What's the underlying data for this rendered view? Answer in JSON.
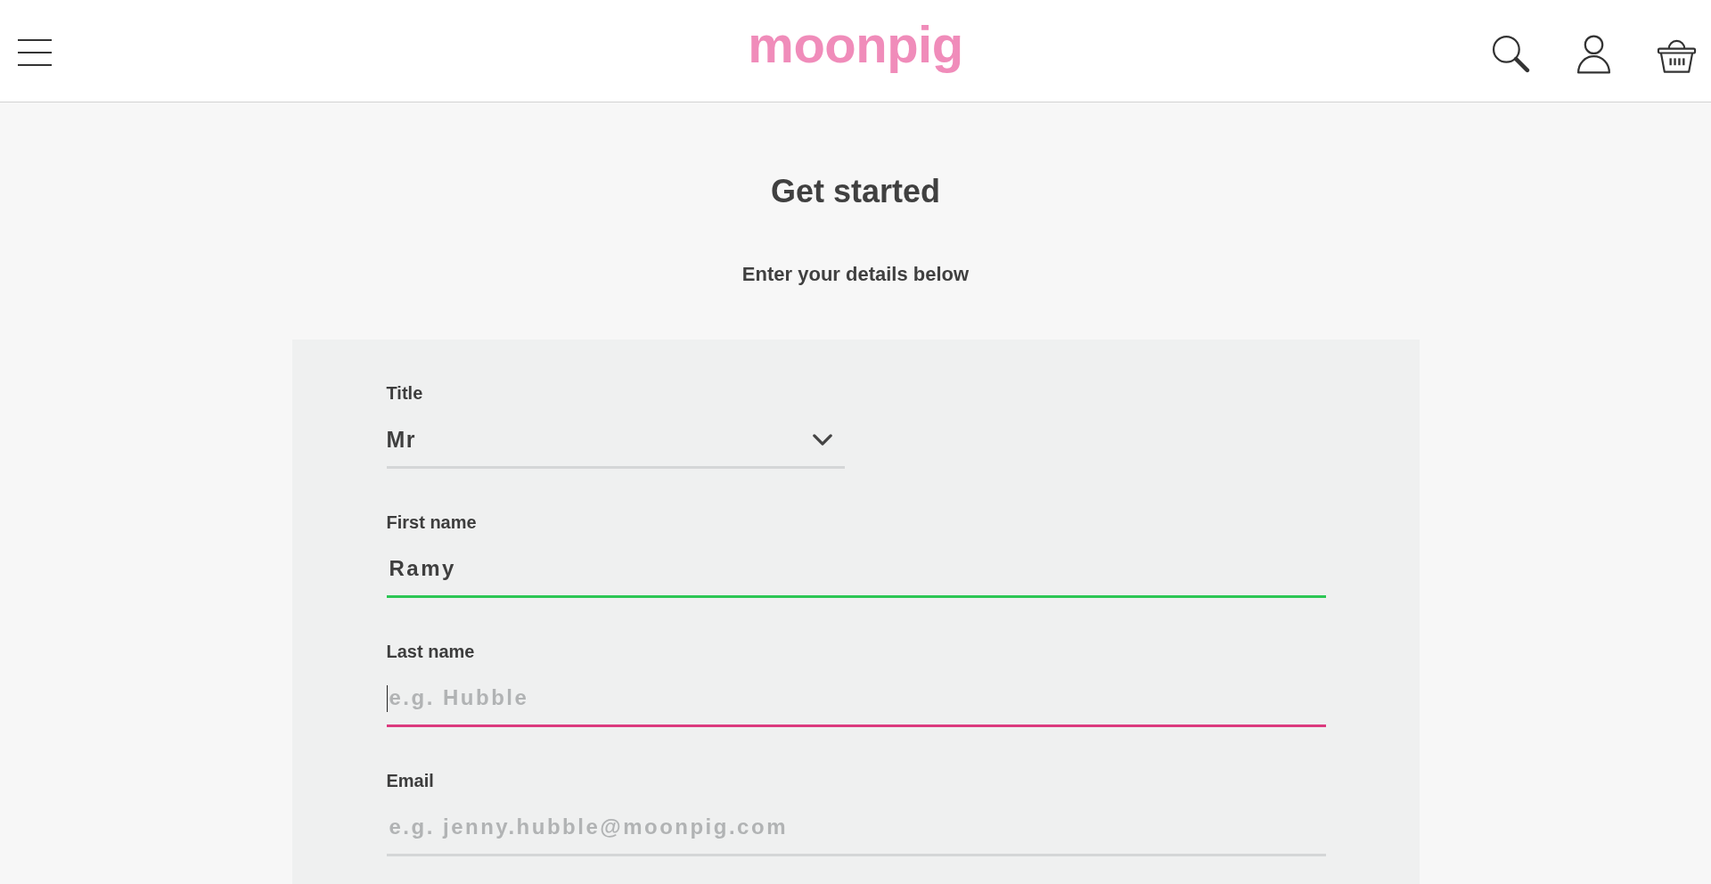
{
  "header": {
    "logo": "moonpig"
  },
  "heading": "Get started",
  "subheading": "Enter your details below",
  "form": {
    "fields": [
      {
        "kind": "select",
        "label": "Title",
        "value": "Mr",
        "valid": false,
        "focused": false
      },
      {
        "kind": "text",
        "label": "First name",
        "value": "Ramy",
        "valid": true,
        "focused": false
      },
      {
        "kind": "text",
        "label": "Last name",
        "placeholder": "e.g. Hubble",
        "valid": false,
        "focused": true
      },
      {
        "kind": "text",
        "label": "Email",
        "placeholder": "e.g. jenny.hubble@moonpig.com",
        "valid": false,
        "focused": false
      }
    ]
  }
}
